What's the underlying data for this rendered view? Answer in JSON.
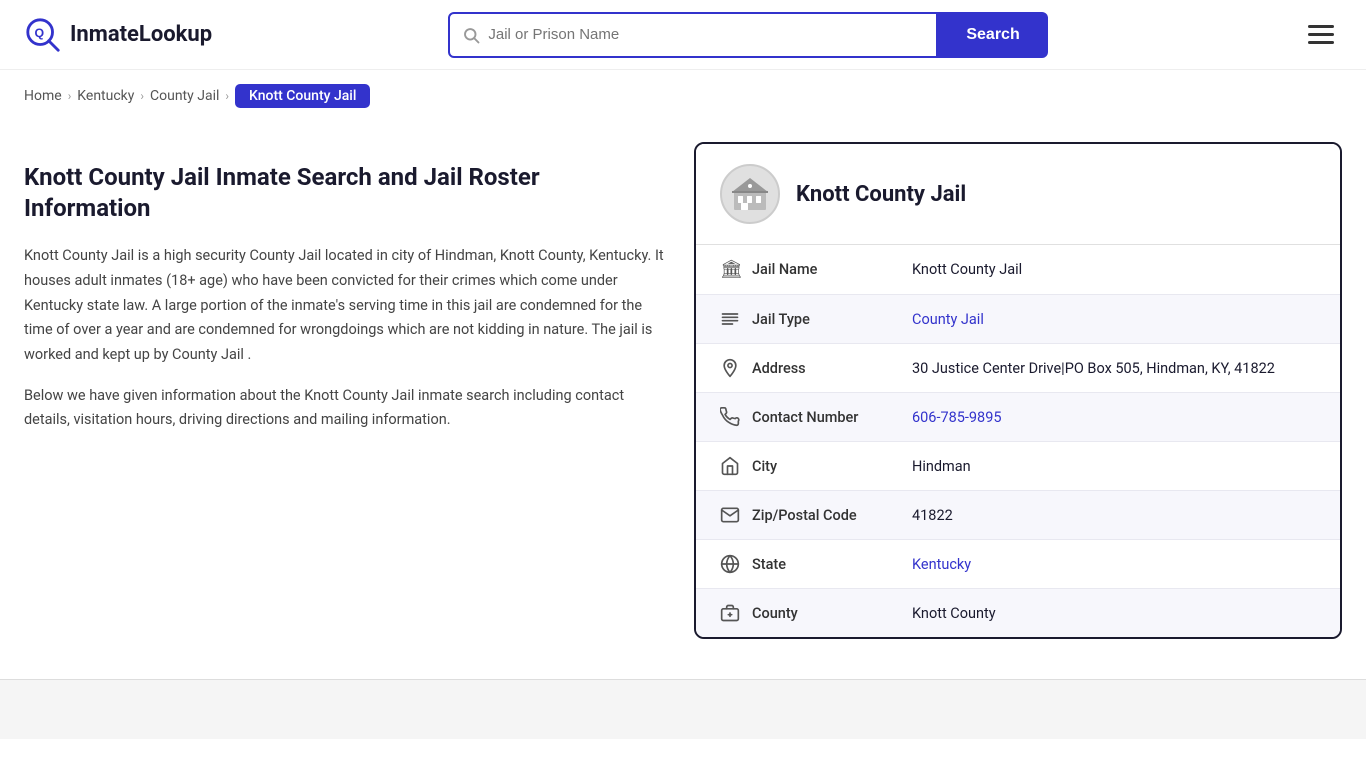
{
  "header": {
    "logo_text_highlight": "Inmate",
    "logo_text_main": "Lookup",
    "search_placeholder": "Jail or Prison Name",
    "search_button_label": "Search"
  },
  "breadcrumb": {
    "items": [
      {
        "label": "Home",
        "href": "#"
      },
      {
        "label": "Kentucky",
        "href": "#"
      },
      {
        "label": "County Jail",
        "href": "#"
      },
      {
        "label": "Knott County Jail",
        "current": true
      }
    ]
  },
  "left": {
    "heading": "Knott County Jail Inmate Search and Jail Roster Information",
    "paragraph1": "Knott County Jail is a high security County Jail located in city of Hindman, Knott County, Kentucky. It houses adult inmates (18+ age) who have been convicted for their crimes which come under Kentucky state law. A large portion of the inmate's serving time in this jail are condemned for the time of over a year and are condemned for wrongdoings which are not kidding in nature. The jail is worked and kept up by County Jail .",
    "paragraph2": "Below we have given information about the Knott County Jail inmate search including contact details, visitation hours, driving directions and mailing information."
  },
  "card": {
    "title": "Knott County Jail",
    "rows": [
      {
        "icon": "jail-icon",
        "label": "Jail Name",
        "value": "Knott County Jail",
        "link": null
      },
      {
        "icon": "list-icon",
        "label": "Jail Type",
        "value": "County Jail",
        "link": "#"
      },
      {
        "icon": "location-icon",
        "label": "Address",
        "value": "30 Justice Center Drive|PO Box 505, Hindman, KY, 41822",
        "link": null
      },
      {
        "icon": "phone-icon",
        "label": "Contact Number",
        "value": "606-785-9895",
        "link": "tel:606-785-9895"
      },
      {
        "icon": "city-icon",
        "label": "City",
        "value": "Hindman",
        "link": null
      },
      {
        "icon": "zip-icon",
        "label": "Zip/Postal Code",
        "value": "41822",
        "link": null
      },
      {
        "icon": "state-icon",
        "label": "State",
        "value": "Kentucky",
        "link": "#"
      },
      {
        "icon": "county-icon",
        "label": "County",
        "value": "Knott County",
        "link": null
      }
    ]
  },
  "icons": {
    "jail-icon": "🏛",
    "list-icon": "☰",
    "location-icon": "📍",
    "phone-icon": "📞",
    "city-icon": "🗺",
    "zip-icon": "✉",
    "state-icon": "🌐",
    "county-icon": "🏢"
  }
}
